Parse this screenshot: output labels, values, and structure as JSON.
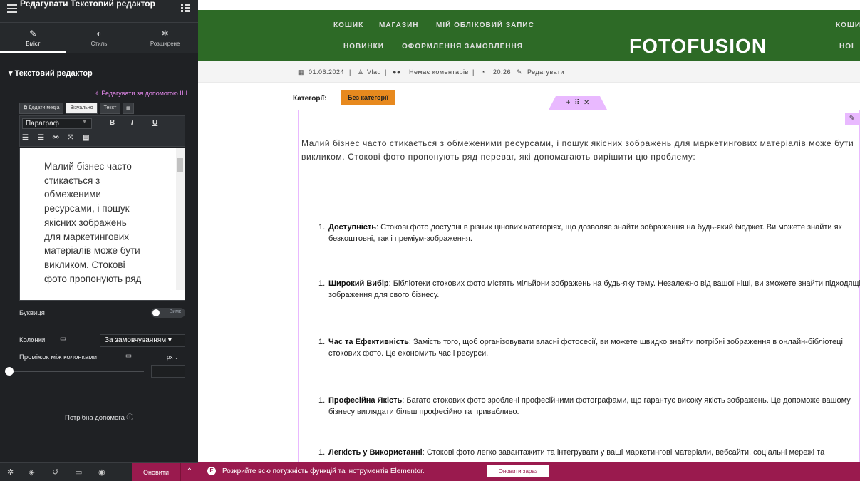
{
  "sidebar": {
    "title": "Редагувати Текстовий редактор",
    "tabs": [
      {
        "label": "Вміст",
        "icon": "pencil-icon"
      },
      {
        "label": "Стиль",
        "icon": "contrast-icon"
      },
      {
        "label": "Розширене",
        "icon": "gear-icon"
      }
    ],
    "section_title": "▾ Текстовий редактор",
    "ai_link": "✧ Редагувати за допомогою ШІ",
    "editor": {
      "add_media": "Додати медіа",
      "visual_tab": "Візуально",
      "text_tab": "Текст",
      "format_select": "Параграф",
      "bold": "B",
      "italic": "I",
      "underline": "U",
      "content": "Малий бізнес часто стикається з обмеженими ресурсами, і пошук якісних зображень для маркетингових матеріалів може бути викликом. Стокові фото пропонують ряд"
    },
    "dropcap_label": "Буквиця",
    "dropcap_toggle": "Вимк",
    "columns_label": "Колонки",
    "columns_value": "За замовчуванням",
    "gap_label": "Проміжок між колонками",
    "gap_unit": "px",
    "help_label": "Потрібна допомога",
    "update_button": "Оновити"
  },
  "site": {
    "nav_row1": [
      "КОШИК",
      "МАГАЗИН",
      "МІЙ ОБЛІКОВИЙ ЗАПИС"
    ],
    "nav_row2": [
      "НОВИНКИ",
      "ОФОРМЛЕННЯ ЗАМОВЛЕННЯ"
    ],
    "logo": "FOTOFUSION",
    "nav_right1": "КОШИ",
    "nav_right2": "НОІ",
    "header_color": "#2d6a26"
  },
  "post": {
    "date": "01.06.2024",
    "author": "Vlad",
    "comments": "Немає коментарів",
    "time": "20:26",
    "edit": "Редагувати",
    "categories_label": "Категорії:",
    "category": "Без категорії",
    "intro": "Малий бізнес часто стикається з обмеженими ресурсами, і пошук якісних зображень для маркетингових матеріалів може бути викликом. Стокові фото пропонують ряд переваг, які допомагають вирішити цю проблему:",
    "items": [
      {
        "num": "1.",
        "title": "Доступність",
        "text": ": Стокові фото доступні в різних цінових категоріях, що дозволяє знайти зображення на будь-який бюджет. Ви можете знайти як безкоштовні, так і преміум-зображення."
      },
      {
        "num": "1.",
        "title": "Широкий Вибір",
        "text": ": Бібліотеки стокових фото містять мільйони зображень на будь-яку тему. Незалежно від вашої ніші, ви зможете знайти підходящі зображення для свого бізнесу."
      },
      {
        "num": "1.",
        "title": "Час та Ефективність",
        "text": ": Замість того, щоб організовувати власні фотосесії, ви можете швидко знайти потрібні зображення в онлайн-бібліотеці стокових фото. Це економить час і ресурси."
      },
      {
        "num": "1.",
        "title": "Професійна Якість",
        "text": ": Багато стокових фото зроблені професійними фотографами, що гарантує високу якість зображень. Це допоможе вашому бізнесу виглядати більш професійно та привабливо."
      },
      {
        "num": "1.",
        "title": "Легкість у Використанні",
        "text": ": Стокові фото легко завантажити та інтегрувати у ваші маркетингові матеріали, вебсайти, соціальні мережі та друковану продукцію."
      }
    ]
  },
  "promo": {
    "text": "Розкрийте всю потужність функцій та інструментів Elementor.",
    "button": "Оновити зараз",
    "color": "#9a1a4e"
  }
}
